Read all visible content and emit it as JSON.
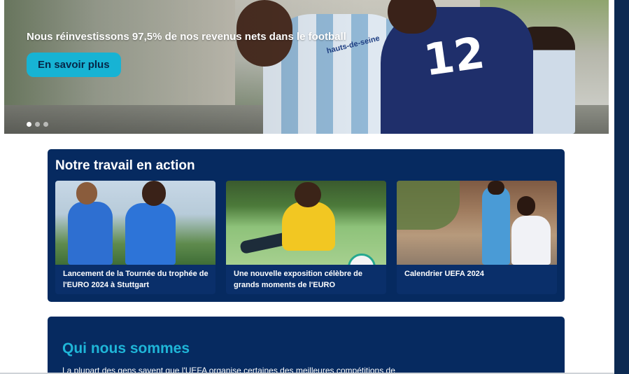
{
  "hero": {
    "title": "Nous réinvestissons 97,5% de nos revenus nets dans le football",
    "cta_label": "En savoir plus",
    "jersey_number": "12",
    "sponsor_text": "hauts-de-seine",
    "slides": {
      "count": 3,
      "active_index": 0
    }
  },
  "work_section": {
    "title": "Notre travail en action",
    "cards": [
      {
        "caption": "Lancement de la Tournée du trophée de l'EURO 2024 à Stuttgart"
      },
      {
        "caption": "Une nouvelle exposition célèbre de grands moments de l'EURO"
      },
      {
        "caption": "Calendrier UEFA 2024"
      }
    ]
  },
  "about_section": {
    "title": "Qui nous sommes",
    "text": "La plupart des gens savent que l'UEFA organise certaines des meilleures compétitions de"
  },
  "colors": {
    "navy_panel": "#062a60",
    "accent_cyan": "#17b3d4",
    "title_cyan": "#1fb6d8",
    "page_bg": "#ffffff"
  }
}
